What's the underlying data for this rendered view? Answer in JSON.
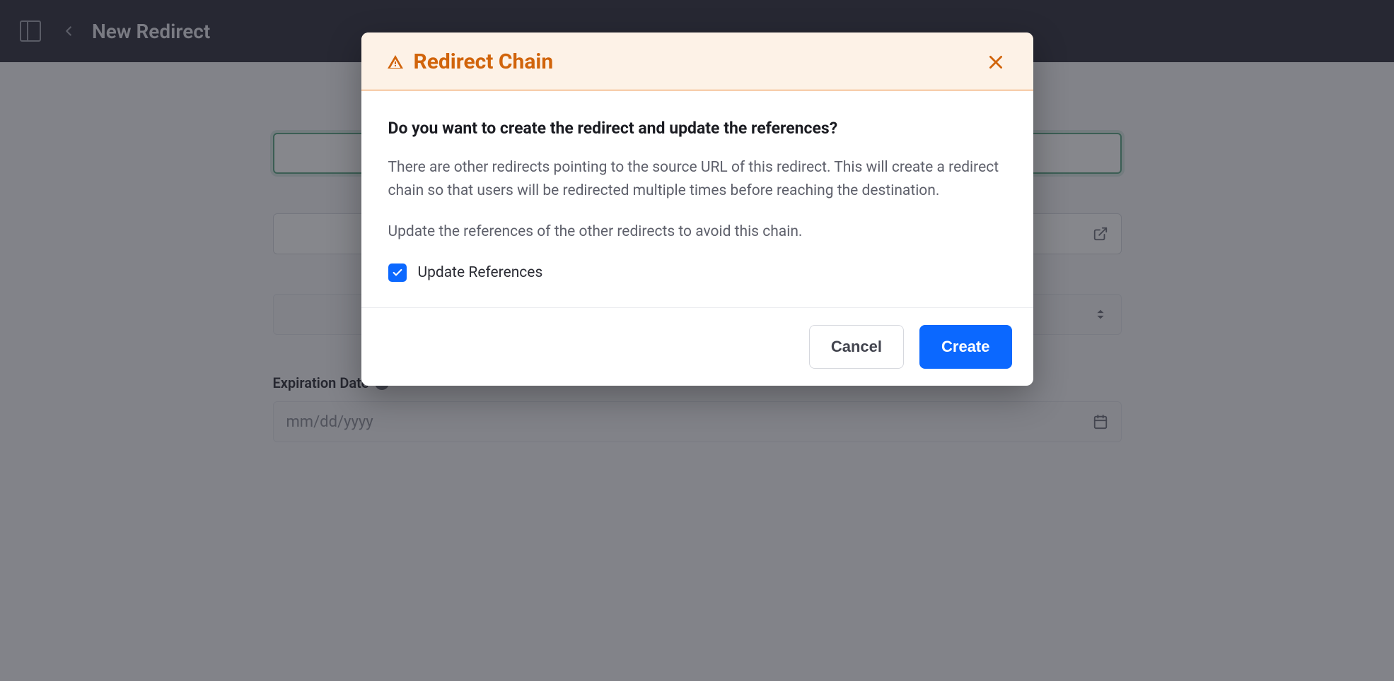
{
  "page": {
    "title": "New Redirect",
    "fields": {
      "expiration": {
        "label": "Expiration Date",
        "placeholder": "mm/dd/yyyy"
      }
    }
  },
  "modal": {
    "title": "Redirect Chain",
    "question": "Do you want to create the redirect and update the references?",
    "paragraph1": "There are other redirects pointing to the source URL of this redirect. This will create a redirect chain so that users will be redirected multiple times before reaching the destination.",
    "paragraph2": "Update the references of the other redirects to avoid this chain.",
    "checkbox_label": "Update References",
    "checkbox_checked": true,
    "buttons": {
      "cancel": "Cancel",
      "create": "Create"
    }
  }
}
